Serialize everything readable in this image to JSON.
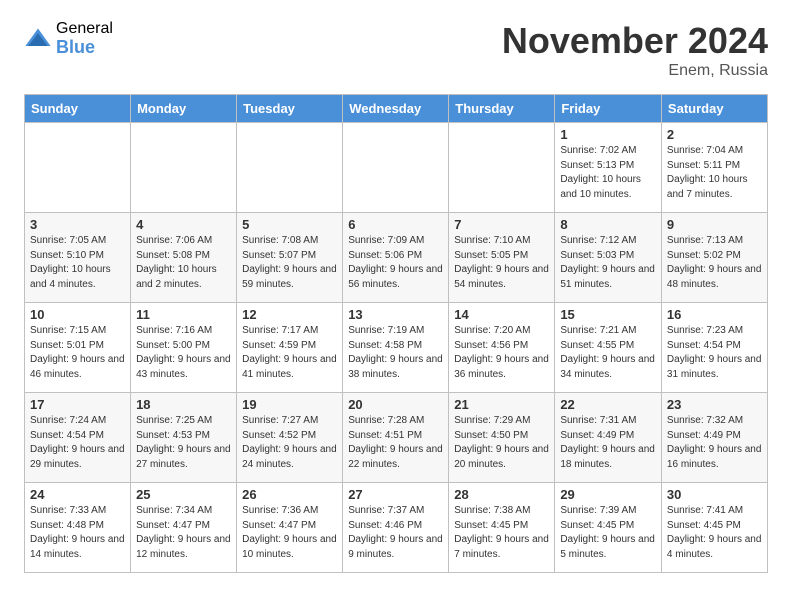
{
  "logo": {
    "general": "General",
    "blue": "Blue"
  },
  "header": {
    "month": "November 2024",
    "location": "Enem, Russia"
  },
  "days_of_week": [
    "Sunday",
    "Monday",
    "Tuesday",
    "Wednesday",
    "Thursday",
    "Friday",
    "Saturday"
  ],
  "weeks": [
    [
      {
        "num": "",
        "info": "",
        "empty": true
      },
      {
        "num": "",
        "info": "",
        "empty": true
      },
      {
        "num": "",
        "info": "",
        "empty": true
      },
      {
        "num": "",
        "info": "",
        "empty": true
      },
      {
        "num": "",
        "info": "",
        "empty": true
      },
      {
        "num": "1",
        "info": "Sunrise: 7:02 AM\nSunset: 5:13 PM\nDaylight: 10 hours and 10 minutes."
      },
      {
        "num": "2",
        "info": "Sunrise: 7:04 AM\nSunset: 5:11 PM\nDaylight: 10 hours and 7 minutes."
      }
    ],
    [
      {
        "num": "3",
        "info": "Sunrise: 7:05 AM\nSunset: 5:10 PM\nDaylight: 10 hours and 4 minutes."
      },
      {
        "num": "4",
        "info": "Sunrise: 7:06 AM\nSunset: 5:08 PM\nDaylight: 10 hours and 2 minutes."
      },
      {
        "num": "5",
        "info": "Sunrise: 7:08 AM\nSunset: 5:07 PM\nDaylight: 9 hours and 59 minutes."
      },
      {
        "num": "6",
        "info": "Sunrise: 7:09 AM\nSunset: 5:06 PM\nDaylight: 9 hours and 56 minutes."
      },
      {
        "num": "7",
        "info": "Sunrise: 7:10 AM\nSunset: 5:05 PM\nDaylight: 9 hours and 54 minutes."
      },
      {
        "num": "8",
        "info": "Sunrise: 7:12 AM\nSunset: 5:03 PM\nDaylight: 9 hours and 51 minutes."
      },
      {
        "num": "9",
        "info": "Sunrise: 7:13 AM\nSunset: 5:02 PM\nDaylight: 9 hours and 48 minutes."
      }
    ],
    [
      {
        "num": "10",
        "info": "Sunrise: 7:15 AM\nSunset: 5:01 PM\nDaylight: 9 hours and 46 minutes."
      },
      {
        "num": "11",
        "info": "Sunrise: 7:16 AM\nSunset: 5:00 PM\nDaylight: 9 hours and 43 minutes."
      },
      {
        "num": "12",
        "info": "Sunrise: 7:17 AM\nSunset: 4:59 PM\nDaylight: 9 hours and 41 minutes."
      },
      {
        "num": "13",
        "info": "Sunrise: 7:19 AM\nSunset: 4:58 PM\nDaylight: 9 hours and 38 minutes."
      },
      {
        "num": "14",
        "info": "Sunrise: 7:20 AM\nSunset: 4:56 PM\nDaylight: 9 hours and 36 minutes."
      },
      {
        "num": "15",
        "info": "Sunrise: 7:21 AM\nSunset: 4:55 PM\nDaylight: 9 hours and 34 minutes."
      },
      {
        "num": "16",
        "info": "Sunrise: 7:23 AM\nSunset: 4:54 PM\nDaylight: 9 hours and 31 minutes."
      }
    ],
    [
      {
        "num": "17",
        "info": "Sunrise: 7:24 AM\nSunset: 4:54 PM\nDaylight: 9 hours and 29 minutes."
      },
      {
        "num": "18",
        "info": "Sunrise: 7:25 AM\nSunset: 4:53 PM\nDaylight: 9 hours and 27 minutes."
      },
      {
        "num": "19",
        "info": "Sunrise: 7:27 AM\nSunset: 4:52 PM\nDaylight: 9 hours and 24 minutes."
      },
      {
        "num": "20",
        "info": "Sunrise: 7:28 AM\nSunset: 4:51 PM\nDaylight: 9 hours and 22 minutes."
      },
      {
        "num": "21",
        "info": "Sunrise: 7:29 AM\nSunset: 4:50 PM\nDaylight: 9 hours and 20 minutes."
      },
      {
        "num": "22",
        "info": "Sunrise: 7:31 AM\nSunset: 4:49 PM\nDaylight: 9 hours and 18 minutes."
      },
      {
        "num": "23",
        "info": "Sunrise: 7:32 AM\nSunset: 4:49 PM\nDaylight: 9 hours and 16 minutes."
      }
    ],
    [
      {
        "num": "24",
        "info": "Sunrise: 7:33 AM\nSunset: 4:48 PM\nDaylight: 9 hours and 14 minutes."
      },
      {
        "num": "25",
        "info": "Sunrise: 7:34 AM\nSunset: 4:47 PM\nDaylight: 9 hours and 12 minutes."
      },
      {
        "num": "26",
        "info": "Sunrise: 7:36 AM\nSunset: 4:47 PM\nDaylight: 9 hours and 10 minutes."
      },
      {
        "num": "27",
        "info": "Sunrise: 7:37 AM\nSunset: 4:46 PM\nDaylight: 9 hours and 9 minutes."
      },
      {
        "num": "28",
        "info": "Sunrise: 7:38 AM\nSunset: 4:45 PM\nDaylight: 9 hours and 7 minutes."
      },
      {
        "num": "29",
        "info": "Sunrise: 7:39 AM\nSunset: 4:45 PM\nDaylight: 9 hours and 5 minutes."
      },
      {
        "num": "30",
        "info": "Sunrise: 7:41 AM\nSunset: 4:45 PM\nDaylight: 9 hours and 4 minutes."
      }
    ]
  ]
}
